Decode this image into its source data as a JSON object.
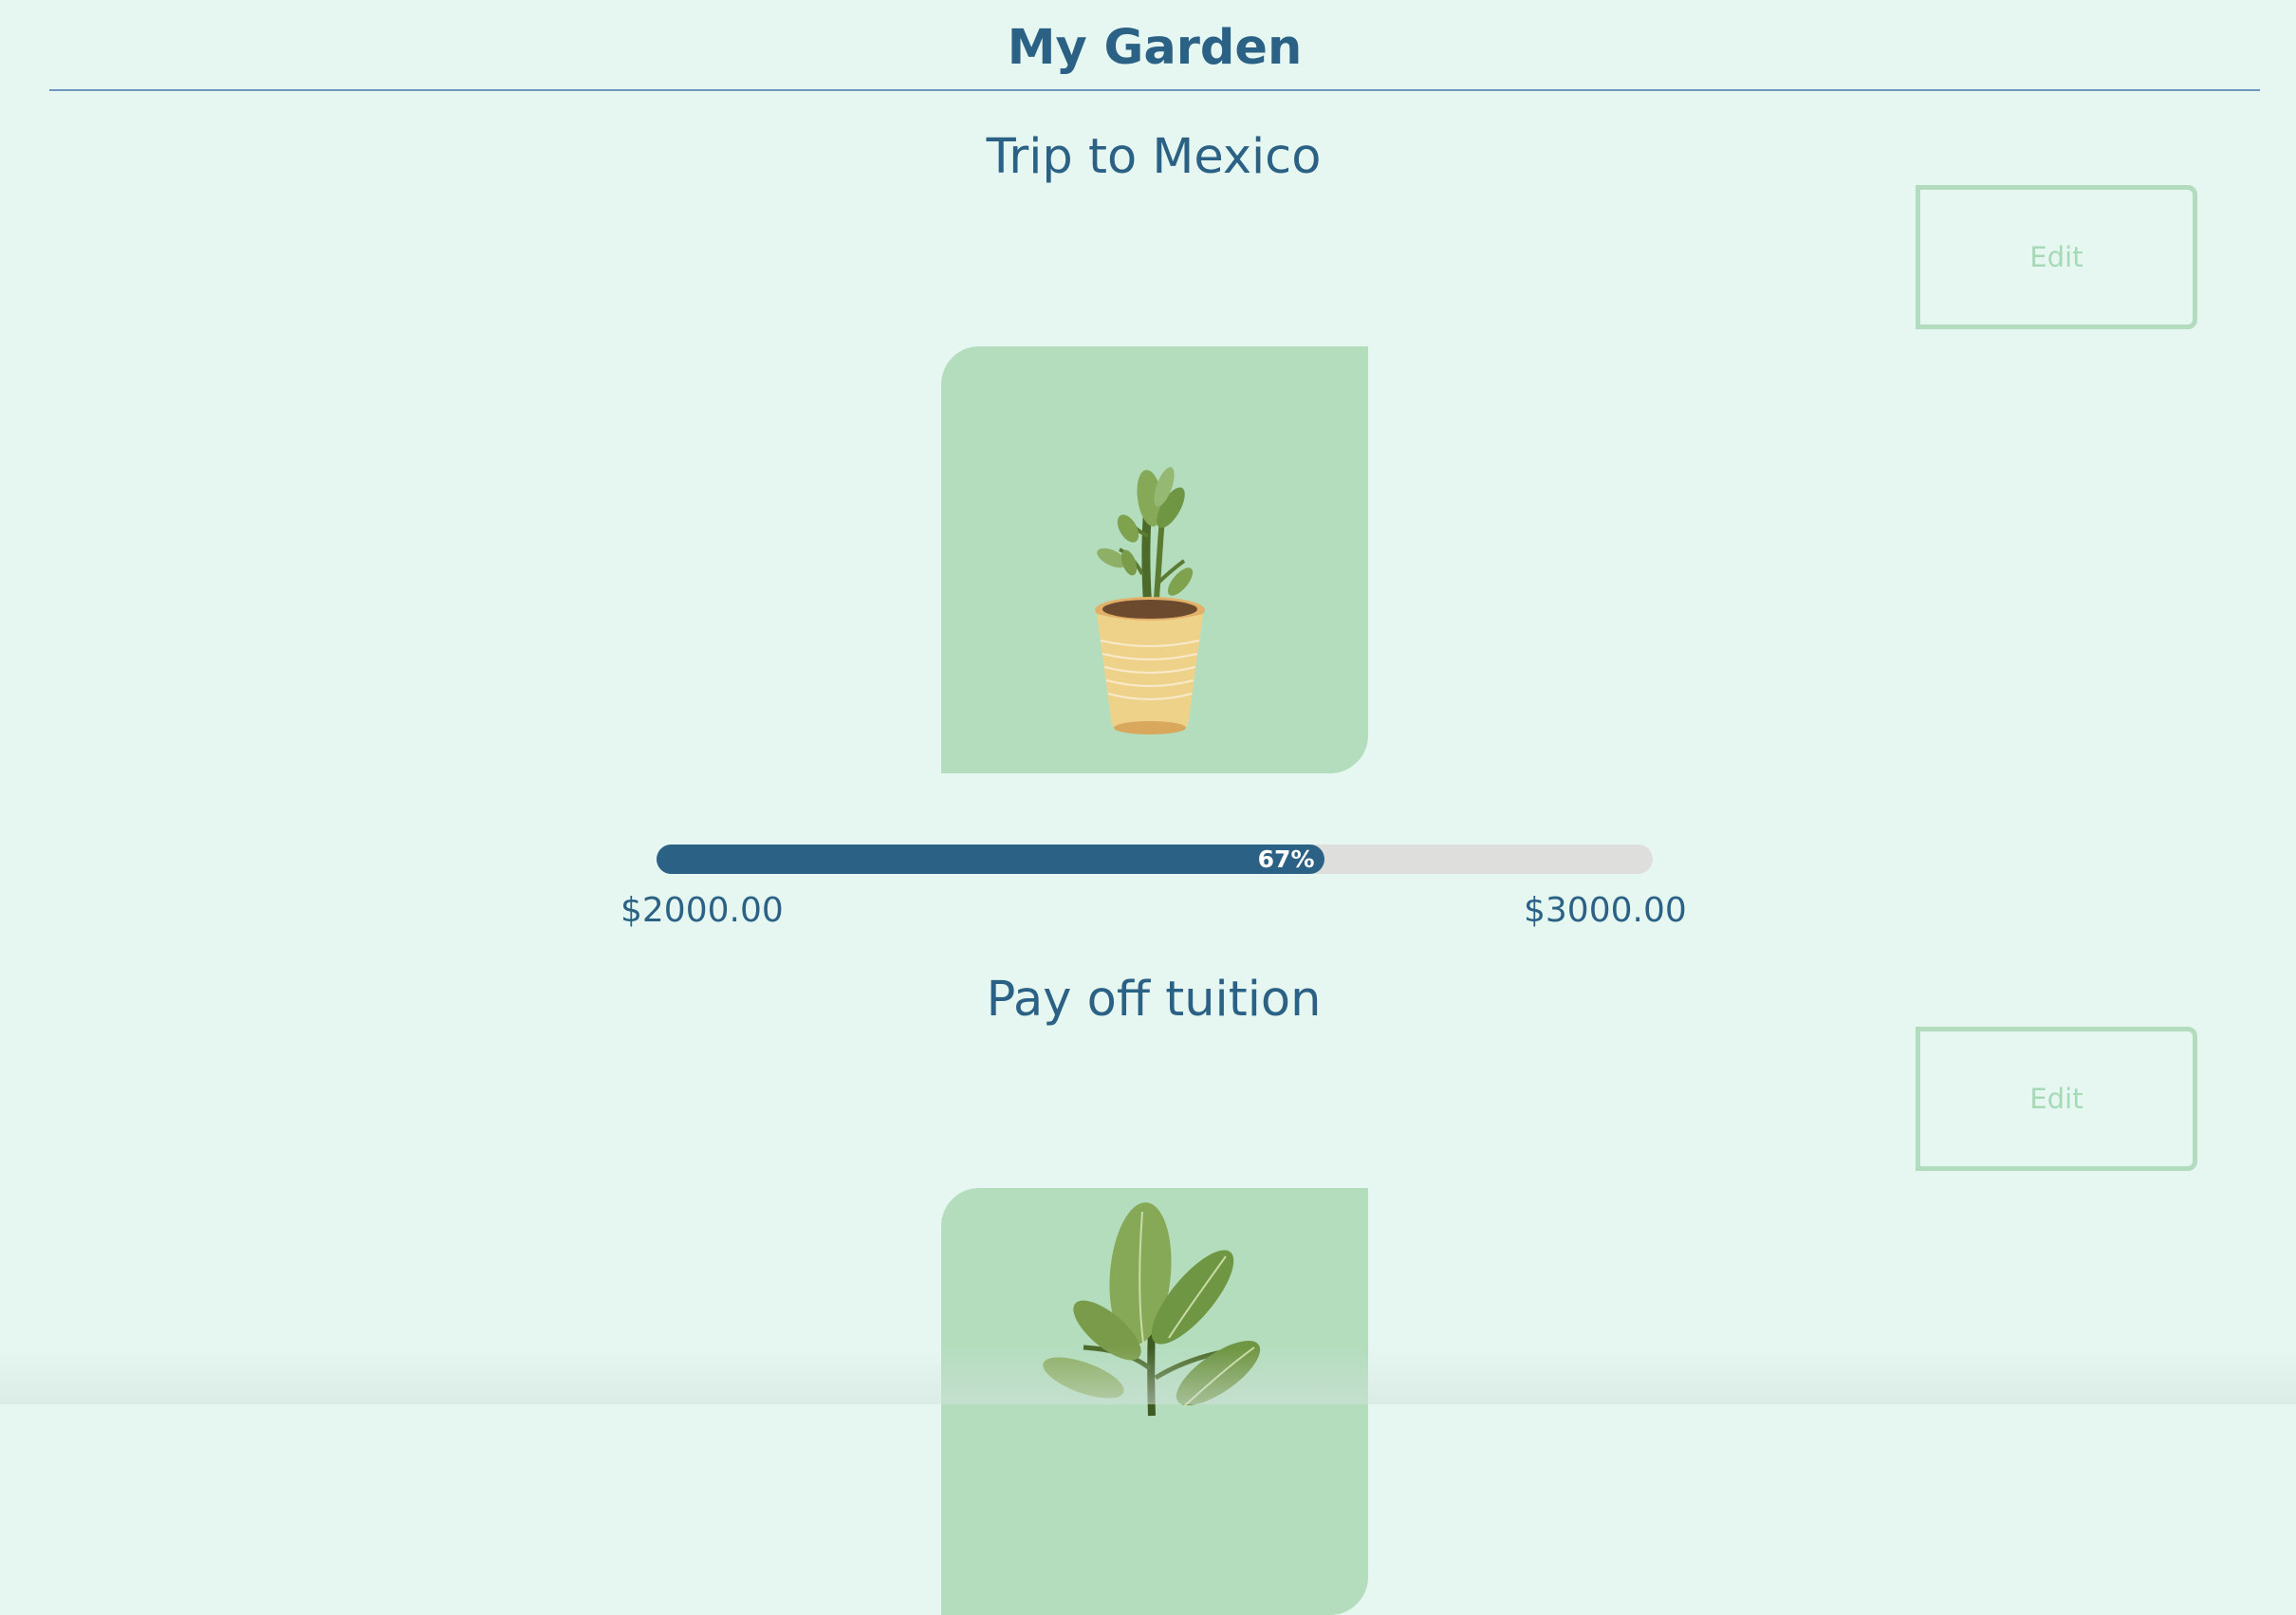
{
  "header": {
    "title": "My Garden"
  },
  "goals": [
    {
      "title": "Trip to Mexico",
      "edit_label": "Edit",
      "progress": 0.67,
      "progress_label": "67%",
      "current_amount": "$2000.00",
      "target_amount": "$3000.00",
      "plant_icon": "sprout-in-pot-icon"
    },
    {
      "title": "Pay off tuition",
      "edit_label": "Edit",
      "plant_icon": "leafy-plant-icon"
    }
  ],
  "colors": {
    "background": "#e6f7f2",
    "primary": "#2b6185",
    "card": "#b4ddbe",
    "edit_border": "#b3dcbe",
    "track": "#dededd"
  }
}
